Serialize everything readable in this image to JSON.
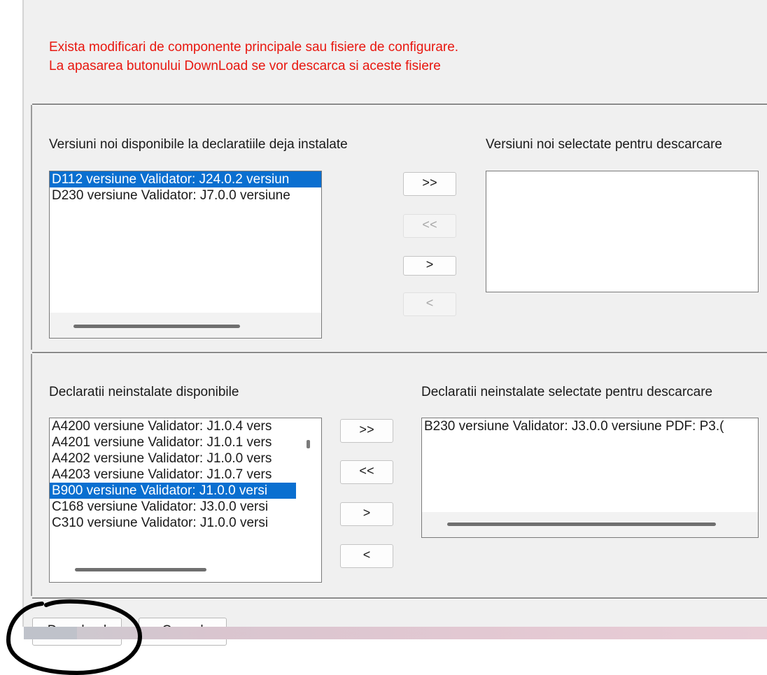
{
  "warning": {
    "line1": "Exista modificari de componente principale sau fisiere de configurare.",
    "line2": "La apasarea butonului DownLoad se vor descarca si aceste fisiere"
  },
  "updates": {
    "available_label": "Versiuni noi disponibile la declaratiile deja instalate",
    "selected_label": "Versiuni noi selectate pentru descarcare",
    "available_items": [
      "D112 versiune Validator: J24.0.2 versiun",
      "D230 versiune Validator: J7.0.0 versiune"
    ],
    "selected_items": []
  },
  "uninstalled": {
    "available_label": "Declaratii neinstalate disponibile",
    "selected_label": "Declaratii neinstalate selectate pentru descarcare",
    "available_items": [
      "A4200 versiune Validator: J1.0.4 vers",
      "A4201 versiune Validator: J1.0.1 vers",
      "A4202 versiune Validator: J1.0.0 vers",
      "A4203 versiune Validator: J1.0.7 vers",
      "B900 versiune Validator: J1.0.0 versi",
      "C168 versiune Validator: J3.0.0 versi",
      "C310 versiune Validator: J1.0.0 versi"
    ],
    "selected_items": [
      "B230 versiune Validator: J3.0.0 versiune PDF: P3.("
    ]
  },
  "buttons": {
    "add_all": ">>",
    "remove_all": "<<",
    "add_one": ">",
    "remove_one": "<"
  },
  "footer": {
    "download_label": "Download",
    "cancel_label": "Cancel"
  }
}
